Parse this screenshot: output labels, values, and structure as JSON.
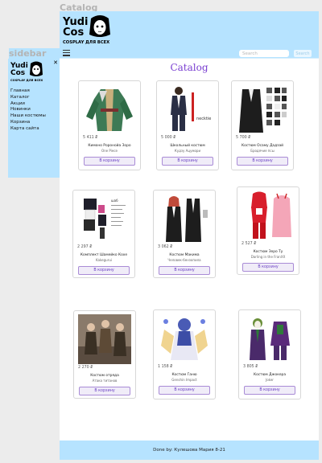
{
  "frames": {
    "catalog_label": "Catalog",
    "sidebar_label": "sidebar"
  },
  "brand": {
    "name_line1": "Yudi",
    "name_line2": "Cos",
    "tagline": "COSPLAY ДЛЯ ВСЕХ"
  },
  "sidebar": {
    "close_label": "✕",
    "items": [
      {
        "label": "Главная"
      },
      {
        "label": "Каталог"
      },
      {
        "label": "Акции"
      },
      {
        "label": "Новинки"
      },
      {
        "label": "Наши костюмы"
      },
      {
        "label": "Корзина"
      },
      {
        "label": "Карта сайта"
      }
    ]
  },
  "search": {
    "placeholder": "Search",
    "button_label": "Search"
  },
  "page": {
    "title": "Catalog"
  },
  "products": [
    {
      "price": "5 411 ₽",
      "name": "Кимоно Роронойа Зоро",
      "sub": "One Piece",
      "button": "В корзину"
    },
    {
      "price": "5 000 ₽",
      "name": "Школьный костюм",
      "sub": "Кудзу Ацумори",
      "button": "В корзину"
    },
    {
      "price": "5 700 ₽",
      "name": "Костюм Осаму Дадзай",
      "sub": "Бродячие псы",
      "button": "В корзину"
    },
    {
      "price": "2 297 ₽",
      "name": "Комплект Шамейко Кохе",
      "sub": "Kakegurui",
      "button": "В корзину"
    },
    {
      "price": "3 062 ₽",
      "name": "Костюм Макима",
      "sub": "Человек-бензопила",
      "button": "В корзину"
    },
    {
      "price": "2 527 ₽",
      "name": "Костюм Зеро Ту",
      "sub": "Darling in the FranXX",
      "button": "В корзину"
    },
    {
      "price": "2 270 ₽",
      "name": "Костюм отряда",
      "sub": "Атака титанов",
      "button": "В корзину"
    },
    {
      "price": "1 158 ₽",
      "name": "Костюм Ганю",
      "sub": "Genshin Impact",
      "button": "В корзину"
    },
    {
      "price": "3 805 ₽",
      "name": "Костюм Джокера",
      "sub": "Joker",
      "button": "В корзину"
    }
  ],
  "footer": {
    "text": "Done by: Кулешова Мария 8-21"
  },
  "colors": {
    "header_bg": "#b6e3ff",
    "accent": "#7a3fd1",
    "button_border": "#a98bd6"
  }
}
